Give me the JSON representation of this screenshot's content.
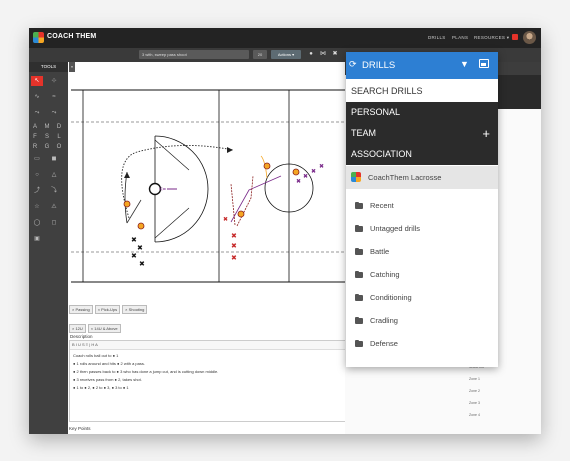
{
  "app": {
    "brand": "COACH THEM"
  },
  "topnav": {
    "links": [
      "DRILLS",
      "PLANS",
      "RESOURCES ▾"
    ]
  },
  "toolbar": {
    "drill_name": "3 with, sweep pass shoot",
    "small_select": "20",
    "button_label": "Actions ▾",
    "icons": [
      "record-icon",
      "share-icon",
      "close-icon"
    ]
  },
  "tools": {
    "header": "TOOLS",
    "collapse": "«",
    "rows": [
      [
        "↖",
        "⊹"
      ],
      [
        "∿",
        "≈"
      ],
      [
        "⤳",
        "⤳"
      ],
      [
        "A",
        "M",
        "D"
      ],
      [
        "F",
        "S",
        "L"
      ],
      [
        "R",
        "G",
        "O"
      ],
      [
        "▭",
        "◼"
      ],
      [
        "○",
        "△"
      ],
      [
        "⤴",
        "⤵"
      ],
      [
        "☆",
        "⚠"
      ],
      [
        "◯",
        "◻"
      ],
      [
        "▣"
      ]
    ]
  },
  "field_annotations": {
    "o_markers": [
      "O",
      "O",
      "O"
    ],
    "x_markers": [
      "X",
      "X",
      "X",
      "X",
      "X",
      "X",
      "X"
    ]
  },
  "tags": {
    "row1": [
      "× Passing",
      "× Pick-Ups",
      "× Shooting"
    ],
    "row2": [
      "× 12U",
      "× 14U & Above"
    ]
  },
  "description": {
    "label": "Description",
    "editor_toolbar": "B  I  U  S  ≡  |  H  A",
    "lines": [
      "Coach rolls ball out to ● 1",
      "● 1 rolls around and hits ● 2 with a pass.",
      "● 2 then passes back to ● 3 who has done a jump cut, and is cutting down middle.",
      "● 3 receives pass from ● 2, takes shot.",
      "● 1 to ● 2, ● 2 to ● 3, ● 3 to ● 1"
    ]
  },
  "keypoints_label": "Key Points",
  "drills_panel": {
    "title": "DRILLS",
    "search_label": "SEARCH DRILLS",
    "sections": [
      "PERSONAL",
      "TEAM",
      "ASSOCIATION"
    ],
    "team_add": "+",
    "association_label": "CoachThem Lacrosse",
    "folders": [
      "Recent",
      "Untagged drills",
      "Battle",
      "Catching",
      "Conditioning",
      "Cradling",
      "Defense"
    ]
  },
  "right_list": [
    "Shoot Ins",
    "Zone 1",
    "Zone 2",
    "Zone 3",
    "Zone 4"
  ],
  "colors": {
    "accent": "#2d7fd3",
    "dark": "#2b2b2b",
    "red": "#e5332a",
    "purple": "#7a2a8a",
    "orange": "#f5a623"
  }
}
